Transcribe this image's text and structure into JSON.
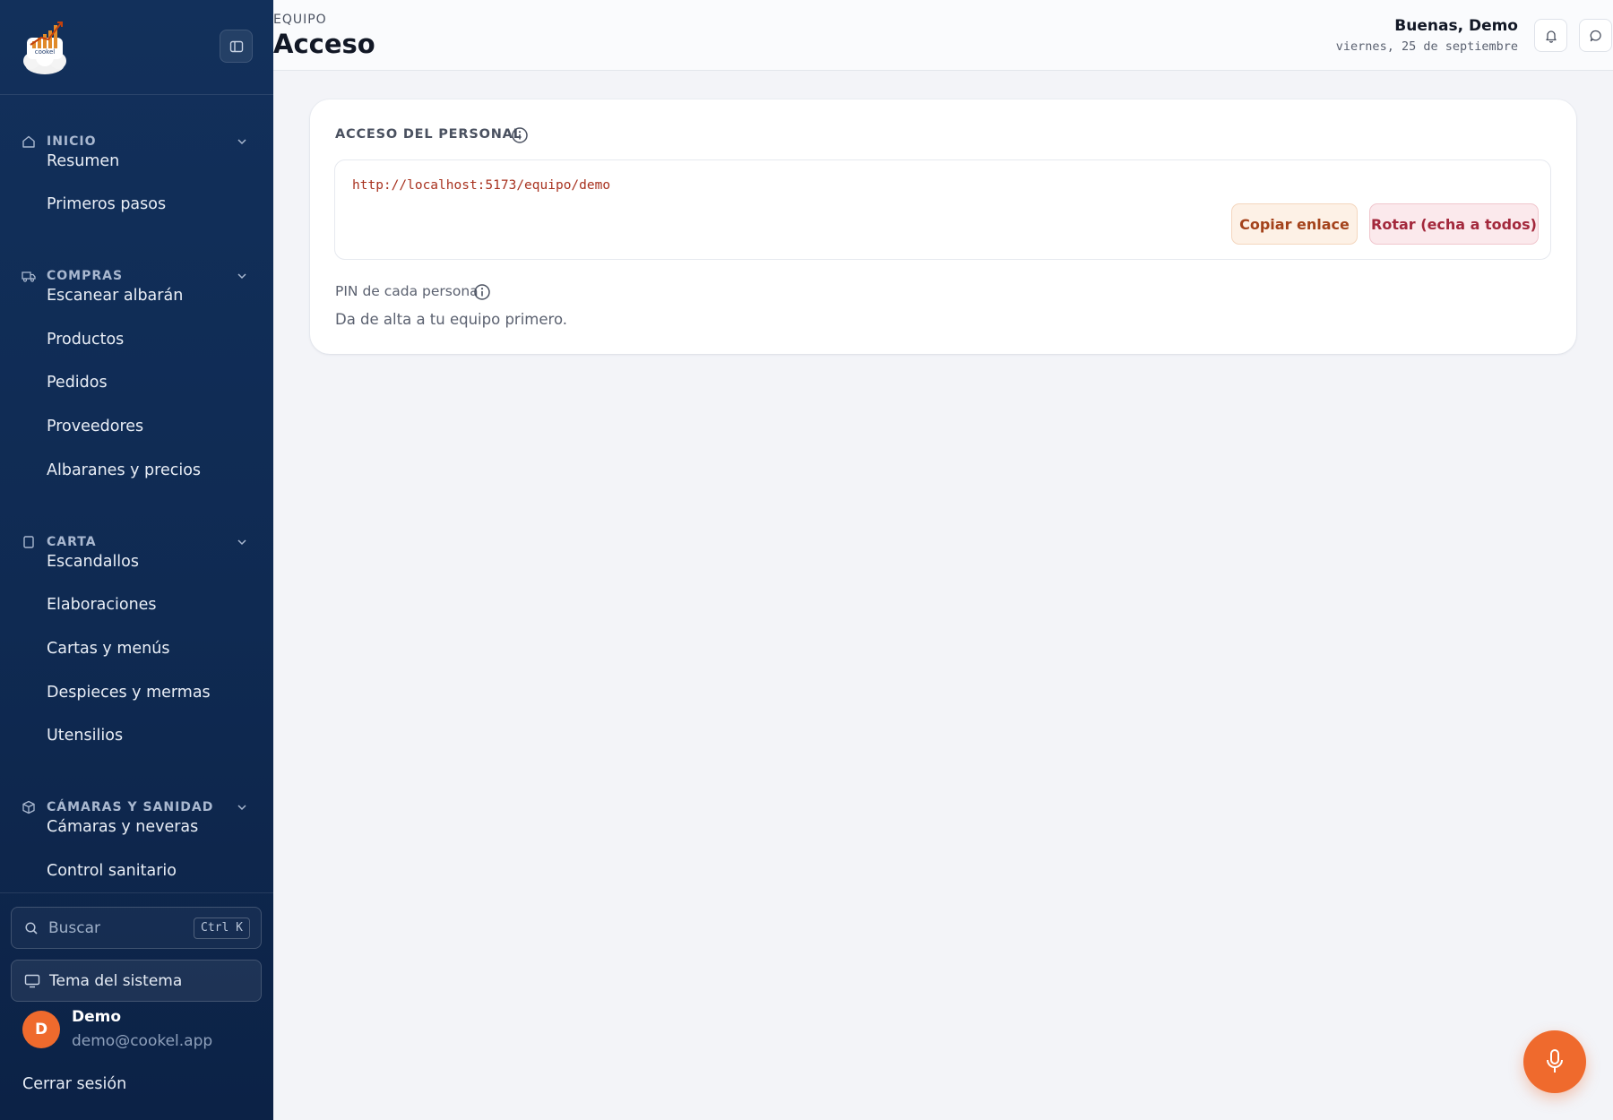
{
  "sidebar": {
    "logo_text": "cookel",
    "sections": [
      {
        "label": "INICIO",
        "icon": "home-icon",
        "items": [
          "Resumen",
          "Primeros pasos"
        ]
      },
      {
        "label": "COMPRAS",
        "icon": "truck-icon",
        "items": [
          "Escanear albarán",
          "Productos",
          "Pedidos",
          "Proveedores",
          "Albaranes y precios"
        ]
      },
      {
        "label": "CARTA",
        "icon": "book-icon",
        "items": [
          "Escandallos",
          "Elaboraciones",
          "Cartas y menús",
          "Despieces y mermas",
          "Utensilios"
        ]
      },
      {
        "label": "CÁMARAS Y SANIDAD",
        "icon": "box-icon",
        "items": [
          "Cámaras y neveras",
          "Control sanitario"
        ]
      }
    ],
    "search": {
      "placeholder": "Buscar",
      "shortcut": "Ctrl K"
    },
    "theme_label": "Tema del sistema",
    "user": {
      "initial": "D",
      "name": "Demo",
      "email": "demo@cookel.app"
    },
    "logout_label": "Cerrar sesión"
  },
  "header": {
    "eyebrow": "EQUIPO",
    "title": "Acceso",
    "greeting": "Buenas, Demo",
    "date": "viernes, 25 de septiembre"
  },
  "card": {
    "title": "ACCESO DEL PERSONAL",
    "url": "http://localhost:5173/equipo/demo",
    "copy_button": "Copiar enlace",
    "rotate_button": "Rotar (echa a todos)",
    "pin_label": "PIN de cada persona",
    "empty_message": "Da de alta a tu equipo primero."
  },
  "colors": {
    "sidebar_bg": "#12305b",
    "accent": "#ef6a2d",
    "url_text": "#a8321f",
    "rotate_text": "#a3283c"
  }
}
